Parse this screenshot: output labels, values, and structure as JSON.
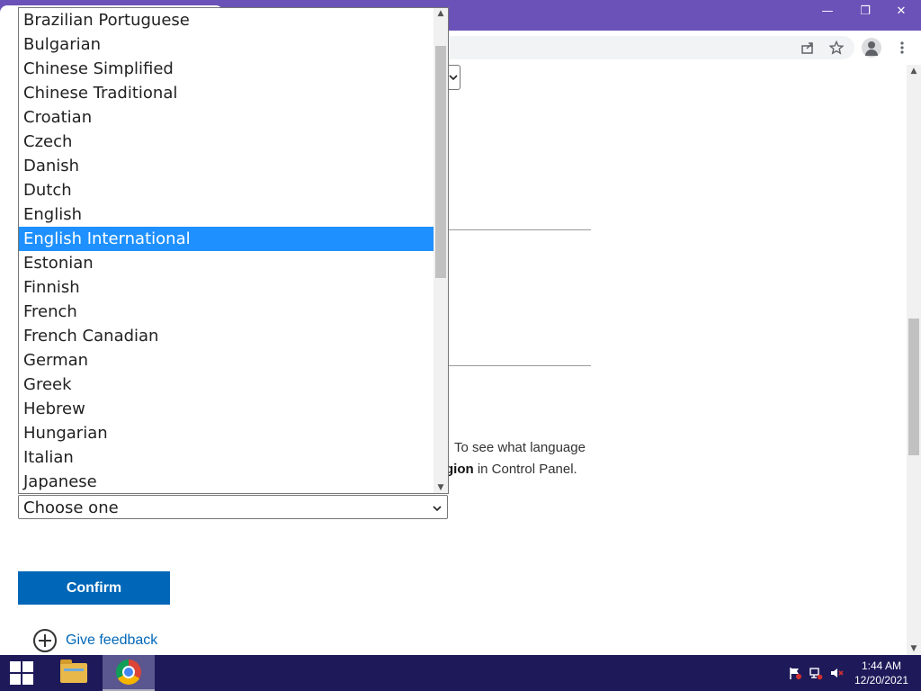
{
  "browser": {
    "window_controls": {
      "minimize": "—",
      "restore": "❐",
      "close": "✕"
    },
    "toolbar_icons": [
      "share-icon",
      "star-icon",
      "profile-icon",
      "menu-icon"
    ]
  },
  "page": {
    "info_line1": "To see what language",
    "info_line2_bold": "gion",
    "info_line2_rest": " in Control Panel.",
    "language_select": {
      "value": "Choose one"
    },
    "confirm_label": "Confirm",
    "feedback_label": "Give feedback"
  },
  "dropdown": {
    "options": [
      "Brazilian Portuguese",
      "Bulgarian",
      "Chinese Simplified",
      "Chinese Traditional",
      "Croatian",
      "Czech",
      "Danish",
      "Dutch",
      "English",
      "English International",
      "Estonian",
      "Finnish",
      "French",
      "French Canadian",
      "German",
      "Greek",
      "Hebrew",
      "Hungarian",
      "Italian",
      "Japanese"
    ],
    "highlighted": "English International"
  },
  "taskbar": {
    "time": "1:44 AM",
    "date": "12/20/2021"
  },
  "colors": {
    "titlebar": "#6b52b8",
    "highlight": "#1e90ff",
    "confirm": "#0067b8",
    "taskbar": "#1e1a5a"
  }
}
